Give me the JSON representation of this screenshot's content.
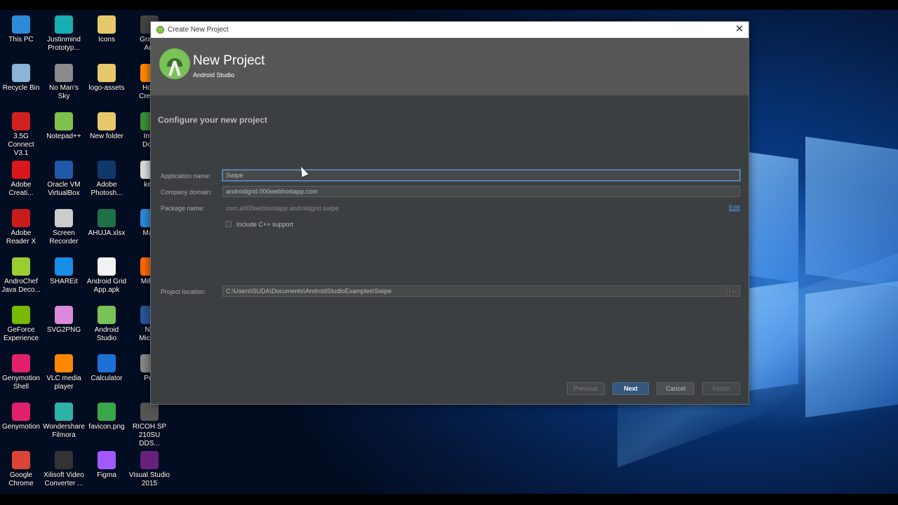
{
  "desktop_icons": [
    {
      "label": "This PC",
      "color": "#2d8ad6"
    },
    {
      "label": "Justinmind\nPrototyp...",
      "color": "#16b0b0"
    },
    {
      "label": "Icons",
      "color": "#e6c96a"
    },
    {
      "label": "Grand\nAut",
      "color": "#444444"
    },
    {
      "label": "Recycle Bin",
      "color": "#8ab4d8"
    },
    {
      "label": "No Man's Sky",
      "color": "#8a8a8a"
    },
    {
      "label": "logo-assets",
      "color": "#e6c96a"
    },
    {
      "label": "How\nCreate",
      "color": "#ff8800"
    },
    {
      "label": "3.5G Connect\nV3.1",
      "color": "#d12020"
    },
    {
      "label": "Notepad++",
      "color": "#7fc24b"
    },
    {
      "label": "New folder",
      "color": "#e6c96a"
    },
    {
      "label": "Inte\nDow",
      "color": "#3b8f3b"
    },
    {
      "label": "Adobe\nCreati...",
      "color": "#d8161b"
    },
    {
      "label": "Oracle VM\nVirtualBox",
      "color": "#1e5aa8"
    },
    {
      "label": "Adobe\nPhotosh...",
      "color": "#0e3a6b"
    },
    {
      "label": "key",
      "color": "#dddddd"
    },
    {
      "label": "Adobe\nReader X",
      "color": "#c81b1b"
    },
    {
      "label": "Screen\nRecorder",
      "color": "#cccccc"
    },
    {
      "label": "AHUJA.xlsx",
      "color": "#1e7145"
    },
    {
      "label": "Mac",
      "color": "#2d8ad6"
    },
    {
      "label": "AndroChef\nJava Deco...",
      "color": "#9acd32"
    },
    {
      "label": "SHAREit",
      "color": "#1a8ee6"
    },
    {
      "label": "Android Grid\nApp.apk",
      "color": "#f2f2f2"
    },
    {
      "label": "MiPC",
      "color": "#ff6900"
    },
    {
      "label": "GeForce\nExperience",
      "color": "#76b900"
    },
    {
      "label": "SVG2PNG",
      "color": "#d88ad8"
    },
    {
      "label": "Android\nStudio",
      "color": "#78c257"
    },
    {
      "label": "Ne\nMicros",
      "color": "#2b579a"
    },
    {
      "label": "Genymotion\nShell",
      "color": "#e0206a"
    },
    {
      "label": "VLC media\nplayer",
      "color": "#ff8800"
    },
    {
      "label": "Calculator",
      "color": "#1e6fd6"
    },
    {
      "label": "Per",
      "color": "#888888"
    },
    {
      "label": "Genymotion",
      "color": "#e0206a"
    },
    {
      "label": "Wondershare\nFilmora",
      "color": "#2db3a6"
    },
    {
      "label": "favicon.png",
      "color": "#3aa64a"
    },
    {
      "label": "RICOH SP\n210SU DDS...",
      "color": "#555555"
    },
    {
      "label": "Google\nChrome",
      "color": "#db4437"
    },
    {
      "label": "Xilisoft Video\nConverter ...",
      "color": "#333333"
    },
    {
      "label": "Figma",
      "color": "#a259ff"
    },
    {
      "label": "Visual Studio\n2015",
      "color": "#68217a"
    }
  ],
  "dialog": {
    "title": "Create New Project",
    "close_glyph": "✕",
    "header_title": "New Project",
    "header_subtitle": "Android Studio",
    "section_title": "Configure your new project",
    "labels": {
      "app_name": "Application name:",
      "company_domain": "Company domain:",
      "package_name": "Package name:",
      "project_location": "Project location:"
    },
    "values": {
      "app_name": "Swipe",
      "company_domain": "androidgrid.000webhostapp.com",
      "package_name": "com.a000webhostapp.androidgrid.swipe",
      "project_location": "C:\\Users\\SUDA\\Documents\\AndroidStudioExamples\\Swipe"
    },
    "edit_link": "Edit",
    "include_cpp_label": "Include C++ support",
    "include_cpp_checked": false,
    "browse_label": "...",
    "buttons": {
      "previous": "Previous",
      "next": "Next",
      "cancel": "Cancel",
      "finish": "Finish"
    }
  },
  "colors": {
    "dialog_bg": "#3c3f41",
    "header_bg": "#565656",
    "primary_button": "#365880",
    "link": "#589df6"
  }
}
